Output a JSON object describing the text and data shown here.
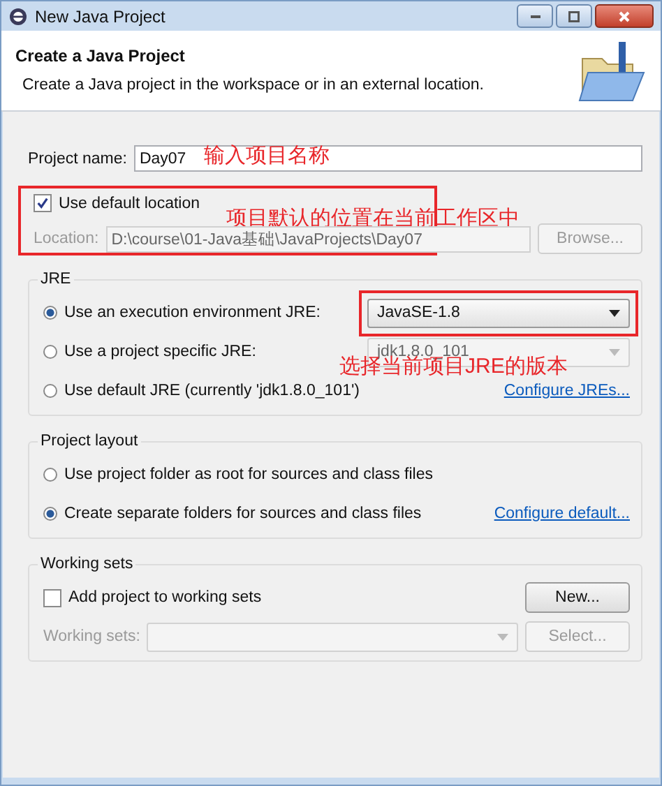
{
  "window": {
    "title": "New Java Project"
  },
  "header": {
    "title": "Create a Java Project",
    "description": "Create a Java project in the workspace or in an external location."
  },
  "project_name": {
    "label": "Project name:",
    "value": "Day07",
    "annotation": "输入项目名称"
  },
  "default_location": {
    "label": "Use default location",
    "checked": true,
    "annotation": "项目默认的位置在当前工作区中"
  },
  "location": {
    "label": "Location:",
    "value": "D:\\course\\01-Java基础\\JavaProjects\\Day07",
    "disabled": true,
    "button": "Browse..."
  },
  "jre": {
    "title": "JRE",
    "annotation": "选择当前项目JRE的版本",
    "options": [
      {
        "kind": "combo",
        "label": "Use an execution environment JRE:",
        "selected": true,
        "value": "JavaSE-1.8",
        "disabled": false,
        "highlighted": true
      },
      {
        "kind": "combo",
        "label": "Use a project specific JRE:",
        "selected": false,
        "value": "jdk1.8.0_101",
        "disabled": true,
        "highlighted": false
      },
      {
        "kind": "link",
        "label": "Use default JRE (currently 'jdk1.8.0_101')",
        "selected": false,
        "link": "Configure JREs..."
      }
    ]
  },
  "project_layout": {
    "title": "Project layout",
    "options": [
      {
        "label": "Use project folder as root for sources and class files",
        "selected": false
      },
      {
        "label": "Create separate folders for sources and class files",
        "selected": true,
        "link": "Configure default..."
      }
    ]
  },
  "working_sets": {
    "title": "Working sets",
    "checkbox": {
      "label": "Add project to working sets",
      "checked": false
    },
    "new_button": "New...",
    "field_label": "Working sets:",
    "field_disabled": true,
    "select_button": "Select..."
  }
}
